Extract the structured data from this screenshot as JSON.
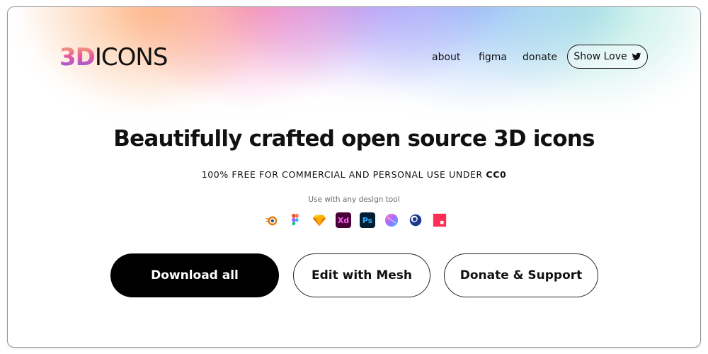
{
  "header": {
    "logo_3d": "3D",
    "logo_icons": "ICONS",
    "nav": [
      {
        "label": "about"
      },
      {
        "label": "figma"
      },
      {
        "label": "donate"
      }
    ],
    "show_love_label": "Show Love",
    "show_love_icon": "twitter-bird-icon"
  },
  "hero": {
    "headline": "Beautifully crafted open source 3D icons",
    "subhead_main": "100% FREE FOR COMMERCIAL AND PERSONAL USE UNDER ",
    "subhead_license": "CC0",
    "tools_caption": "Use with any design tool",
    "tools": [
      {
        "icon": "blender-icon"
      },
      {
        "icon": "figma-icon"
      },
      {
        "icon": "sketch-icon"
      },
      {
        "icon": "adobe-xd-icon",
        "text": "Xd"
      },
      {
        "icon": "photoshop-icon",
        "text": "Ps"
      },
      {
        "icon": "spline-icon"
      },
      {
        "icon": "cinema4d-icon"
      },
      {
        "icon": "vectary-icon"
      }
    ]
  },
  "actions": {
    "download_label": "Download all",
    "mesh_label": "Edit with Mesh",
    "donate_label": "Donate & Support"
  },
  "colors": {
    "dark_button": "#000000",
    "xd_bg": "#470137",
    "xd_fg": "#ff61f6",
    "ps_bg": "#001e36",
    "ps_fg": "#31a8ff"
  }
}
